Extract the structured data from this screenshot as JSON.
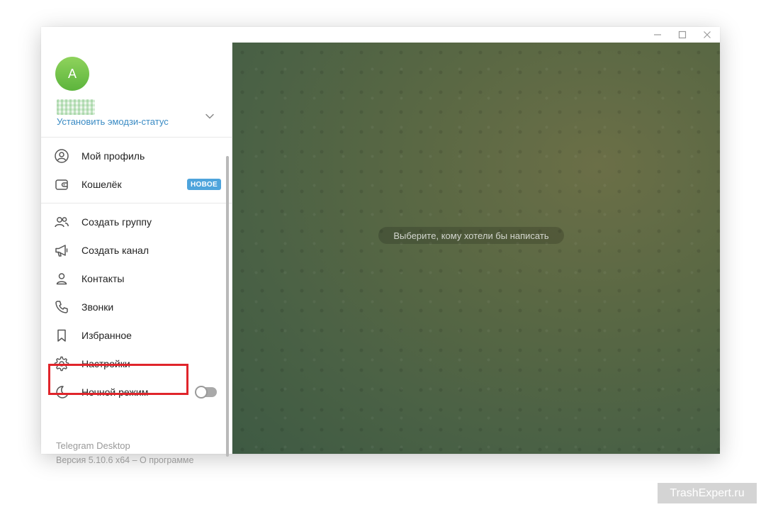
{
  "window": {
    "controls": {
      "minimize": "—",
      "maximize": "☐",
      "close": "✕"
    }
  },
  "profile": {
    "avatar_letter": "A",
    "avatar_color": "#6cc04a",
    "set_emoji_status": "Установить эмодзи-статус"
  },
  "menu": {
    "items": [
      {
        "label": "Мой профиль",
        "icon": "user-circle-icon"
      },
      {
        "label": "Кошелёк",
        "icon": "wallet-icon",
        "badge": "НОВОЕ"
      },
      {
        "label": "Создать группу",
        "icon": "group-icon"
      },
      {
        "label": "Создать канал",
        "icon": "megaphone-icon"
      },
      {
        "label": "Контакты",
        "icon": "person-icon"
      },
      {
        "label": "Звонки",
        "icon": "phone-icon"
      },
      {
        "label": "Избранное",
        "icon": "bookmark-icon"
      },
      {
        "label": "Настройки",
        "icon": "gear-icon"
      },
      {
        "label": "Ночной режим",
        "icon": "moon-icon",
        "toggle": false
      }
    ]
  },
  "footer": {
    "app_name": "Telegram Desktop",
    "version": "Версия 5.10.6 x64 – О программе"
  },
  "chat": {
    "empty_text": "Выберите, кому хотели бы написать"
  },
  "watermark": "TrashExpert.ru",
  "colors": {
    "accent": "#3a8bc4",
    "badge": "#4ea4dc",
    "highlight": "#e0252b"
  }
}
